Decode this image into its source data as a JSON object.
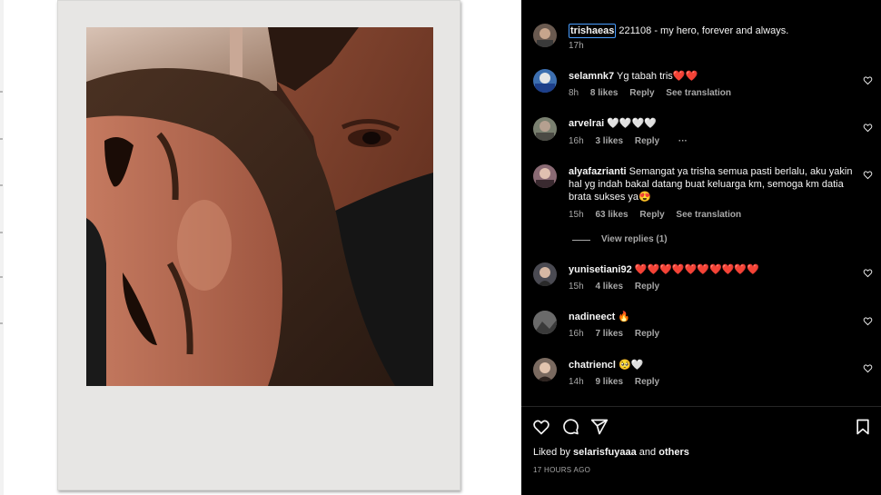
{
  "post": {
    "caption_user": "trishaeas",
    "caption_text": "221108 - my hero, forever and always.",
    "caption_time": "17h"
  },
  "comments": [
    {
      "user": "selamnk7",
      "text": "Yg tabah tris❤️❤️",
      "time": "8h",
      "likes": "8 likes",
      "reply": "Reply",
      "translate": "See translation"
    },
    {
      "user": "arvelrai",
      "text": "🤍🤍🤍🤍",
      "time": "16h",
      "likes": "3 likes",
      "reply": "Reply",
      "more": "···"
    },
    {
      "user": "alyafazrianti",
      "text": "Semangat ya trisha semua pasti berlalu, aku yakin hal yg indah bakal datang buat keluarga km, semoga km datia brata sukses ya😍",
      "time": "15h",
      "likes": "63 likes",
      "reply": "Reply",
      "translate": "See translation"
    },
    {
      "user": "yunisetiani92",
      "text": "❤️❤️❤️❤️❤️❤️❤️❤️❤️❤️",
      "time": "15h",
      "likes": "4 likes",
      "reply": "Reply"
    },
    {
      "user": "nadineect",
      "text": "🔥",
      "time": "16h",
      "likes": "7 likes",
      "reply": "Reply"
    },
    {
      "user": "chatriencl",
      "text": "🥺🤍",
      "time": "14h",
      "likes": "9 likes",
      "reply": "Reply"
    }
  ],
  "view_replies": "View replies (1)",
  "footer": {
    "liked_prefix": "Liked by ",
    "liked_user": "selarisfuyaaa",
    "liked_and": " and ",
    "liked_others": "others",
    "timestamp": "17 HOURS AGO"
  },
  "icons": {
    "like": "heart-icon",
    "comment": "comment-icon",
    "share": "share-icon",
    "save": "bookmark-icon"
  },
  "colors": {
    "panel_bg": "#000000",
    "text_primary": "#f5f5f5",
    "text_secondary": "#a8a8a8",
    "selection_border": "#4a9eff"
  }
}
